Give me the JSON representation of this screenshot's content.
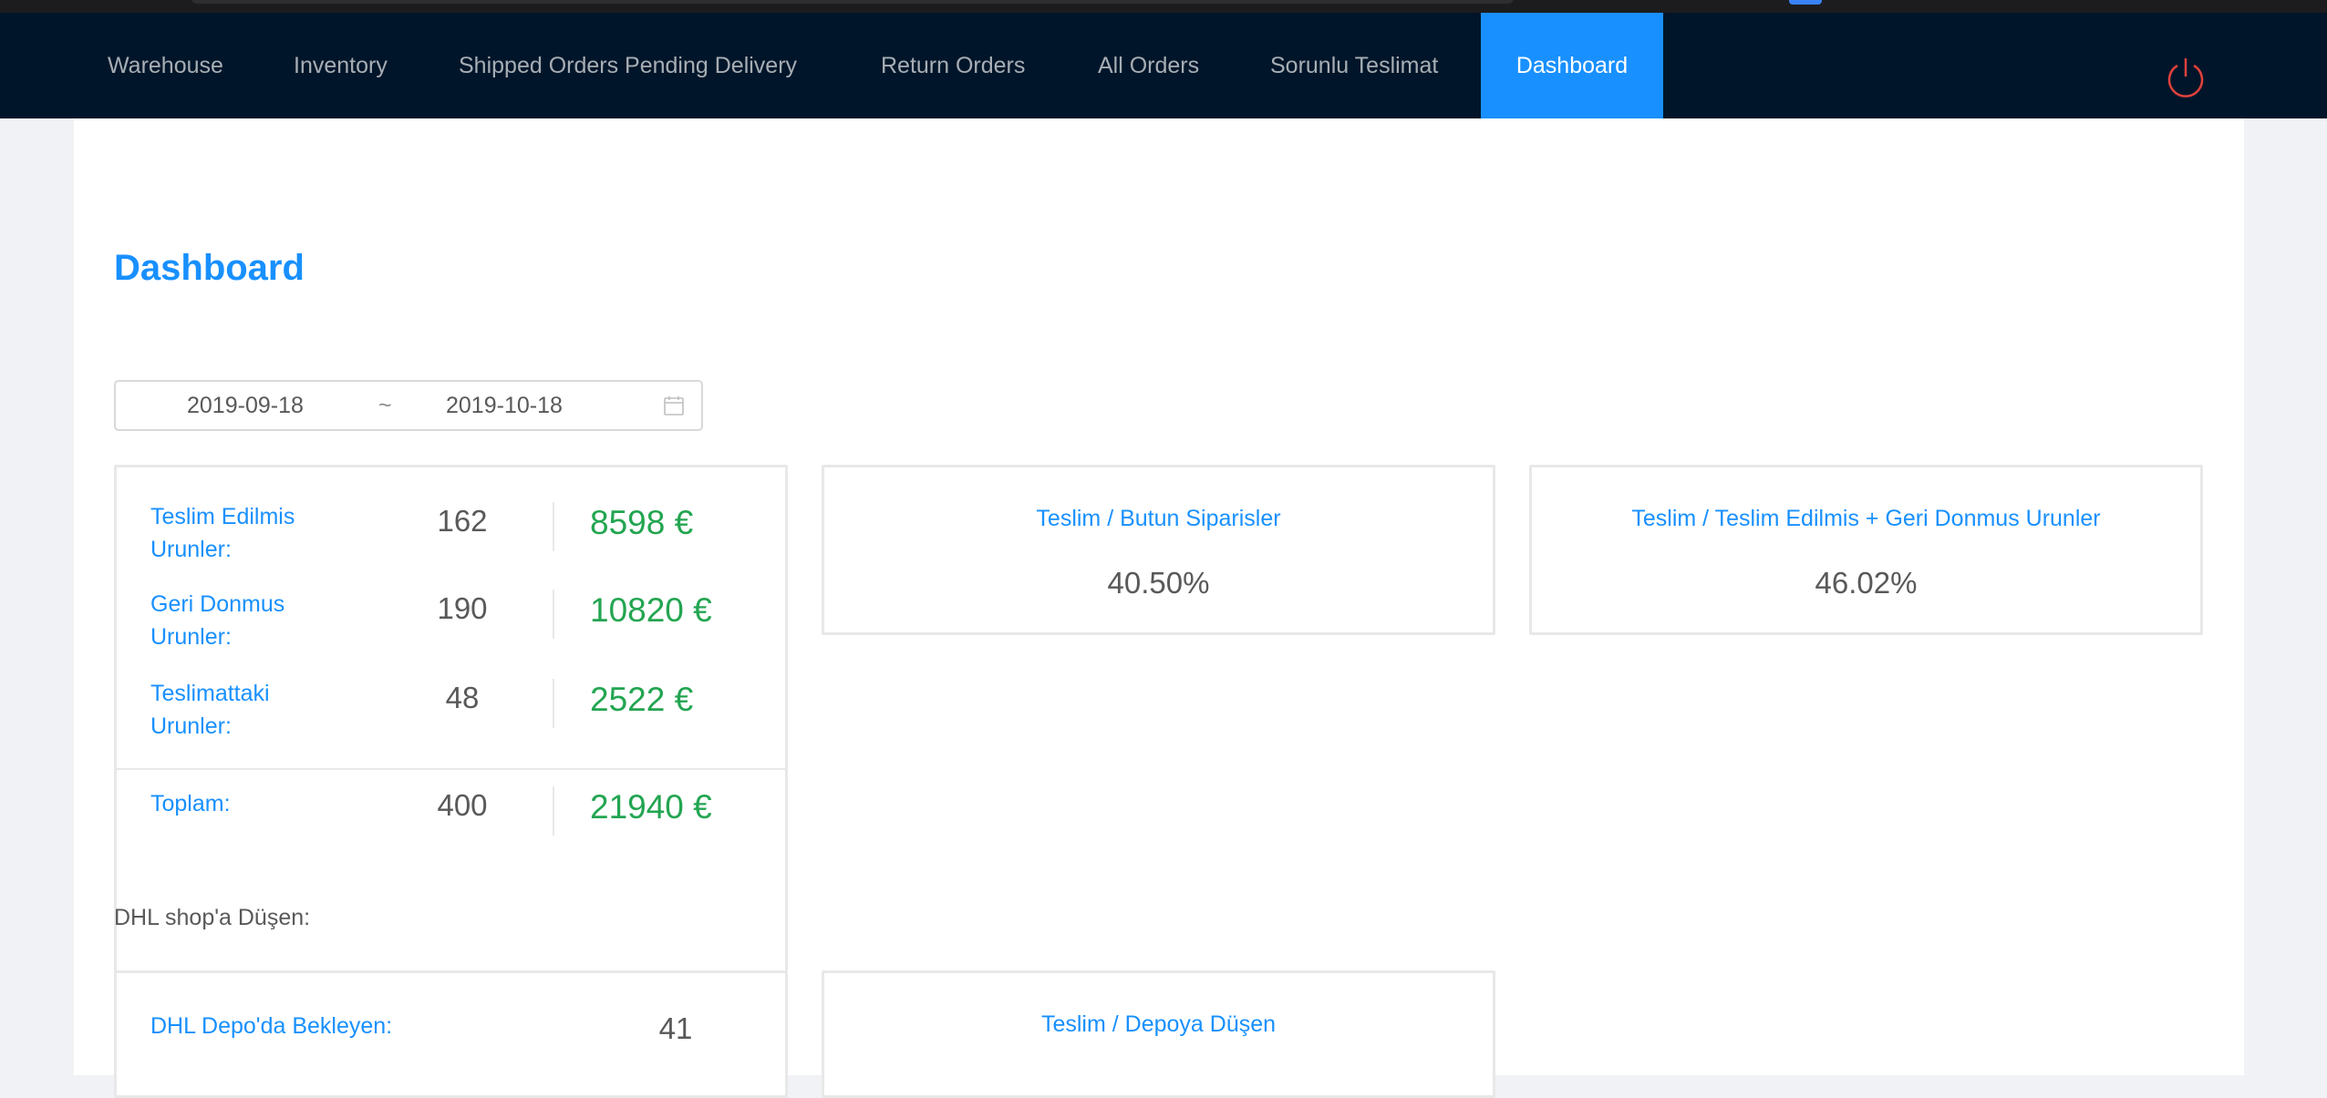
{
  "nav": {
    "items": [
      {
        "label": "Warehouse"
      },
      {
        "label": "Inventory"
      },
      {
        "label": "Shipped Orders Pending Delivery"
      },
      {
        "label": "Return Orders"
      },
      {
        "label": "All Orders"
      },
      {
        "label": "Sorunlu Teslimat"
      },
      {
        "label": "Dashboard"
      }
    ],
    "active": "Dashboard",
    "power_icon": "power-icon",
    "active_color": "#1890ff",
    "bg_color": "#001529"
  },
  "page": {
    "title": "Dashboard"
  },
  "date_range": {
    "start": "2019-09-18",
    "separator": "~",
    "end": "2019-10-18",
    "icon": "calendar-icon"
  },
  "summary": {
    "rows": [
      {
        "label": "Teslim Edilmis Urunler:",
        "count": "162",
        "value": "8598 €"
      },
      {
        "label": "Geri Donmus Urunler:",
        "count": "190",
        "value": "10820 €"
      },
      {
        "label": "Teslimattaki Urunler:",
        "count": "48",
        "value": "2522 €"
      }
    ],
    "total": {
      "label": "Toplam:",
      "count": "400",
      "value": "21940 €"
    },
    "value_color": "#23a551"
  },
  "ratios": [
    {
      "title": "Teslim / Butun Siparisler",
      "value": "40.50%"
    },
    {
      "title": "Teslim / Teslim Edilmis + Geri Donmus Urunler",
      "value": "46.02%"
    }
  ],
  "dhl": {
    "section_label": "DHL shop'a Düşen:",
    "waiting_label": "DHL Depo'da Bekleyen:",
    "waiting_count": "41",
    "ratio_title": "Teslim / Depoya Düşen"
  }
}
